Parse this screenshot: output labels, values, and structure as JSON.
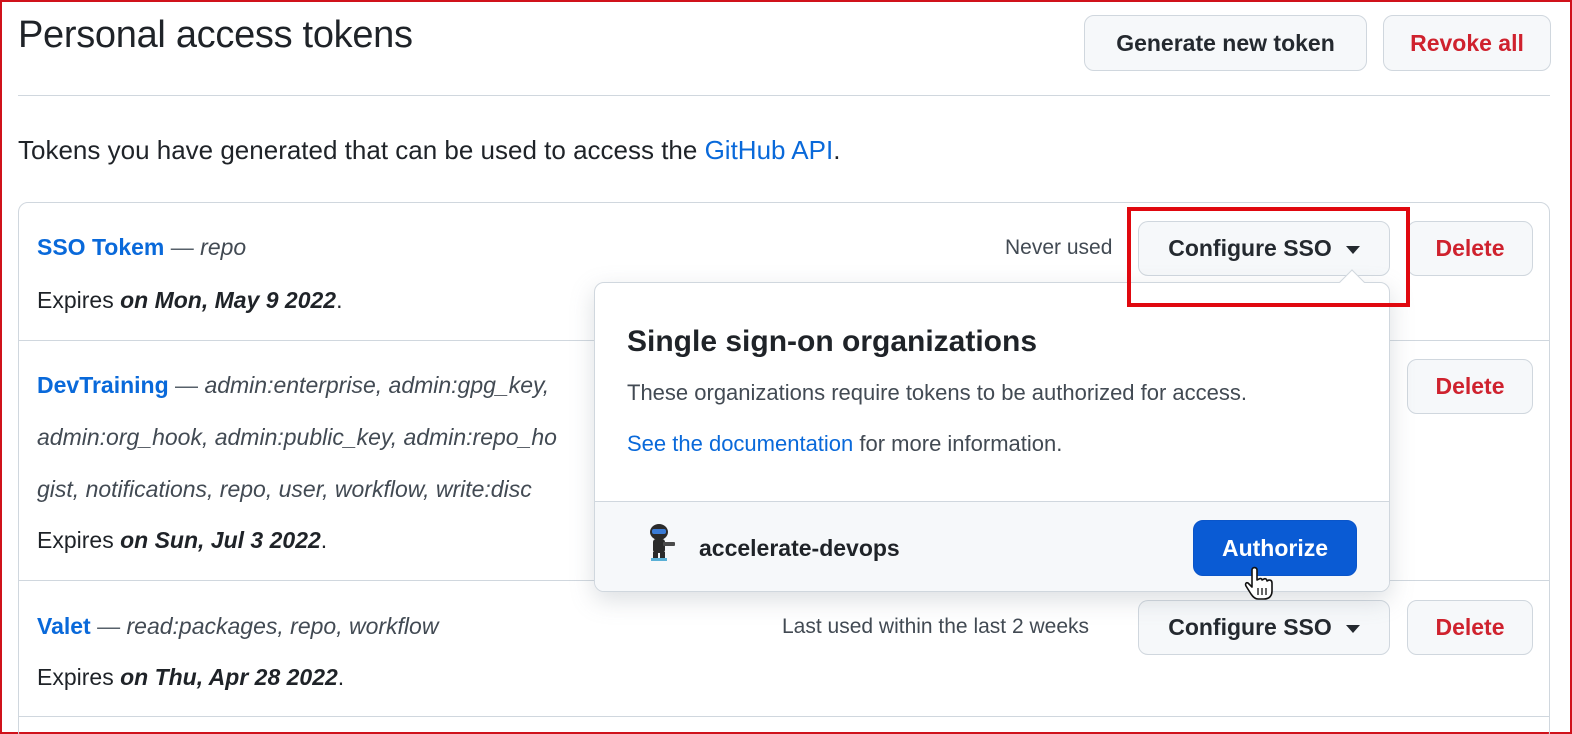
{
  "header": {
    "title": "Personal access tokens",
    "generate_label": "Generate new token",
    "revoke_label": "Revoke all"
  },
  "intro": {
    "text": "Tokens you have generated that can be used to access the ",
    "link": "GitHub API",
    "suffix": "."
  },
  "tokens": [
    {
      "name": "SSO Tokem",
      "dash": " — ",
      "scopes": [
        "repo"
      ],
      "usage": "Never used",
      "expires_prefix": "Expires ",
      "expires_date": "on Mon, May 9 2022",
      "expires_suffix": ".",
      "sso_label": "Configure SSO",
      "delete_label": "Delete"
    },
    {
      "name": "DevTraining",
      "dash": " — ",
      "scope_lines": [
        "admin:enterprise, admin:gpg_key,",
        "admin:org_hook, admin:public_key, admin:repo_ho",
        "gist, notifications, repo, user, workflow, write:disc"
      ],
      "expires_prefix": "Expires ",
      "expires_date": "on Sun, Jul 3 2022",
      "expires_suffix": ".",
      "delete_label": "Delete"
    },
    {
      "name": "Valet",
      "dash": " — ",
      "scopes": [
        "read:packages, repo, workflow"
      ],
      "usage": "Last used within the last 2 weeks",
      "expires_prefix": "Expires ",
      "expires_date": "on Thu, Apr 28 2022",
      "expires_suffix": ".",
      "sso_label": "Configure SSO",
      "delete_label": "Delete"
    }
  ],
  "popover": {
    "title": "Single sign-on organizations",
    "description": "These organizations require tokens to be authorized for access.",
    "doc_link": "See the documentation",
    "doc_suffix": " for more information.",
    "org_name": "accelerate-devops",
    "authorize_label": "Authorize"
  },
  "colors": {
    "link": "#0969da",
    "danger": "#cf222e",
    "primary": "#0a5bd4",
    "highlight": "#e0080f"
  },
  "icons": {
    "caret": "chevron-down-icon",
    "org_avatar": "octocat-avatar-icon",
    "cursor": "hand-pointer-cursor-icon"
  }
}
